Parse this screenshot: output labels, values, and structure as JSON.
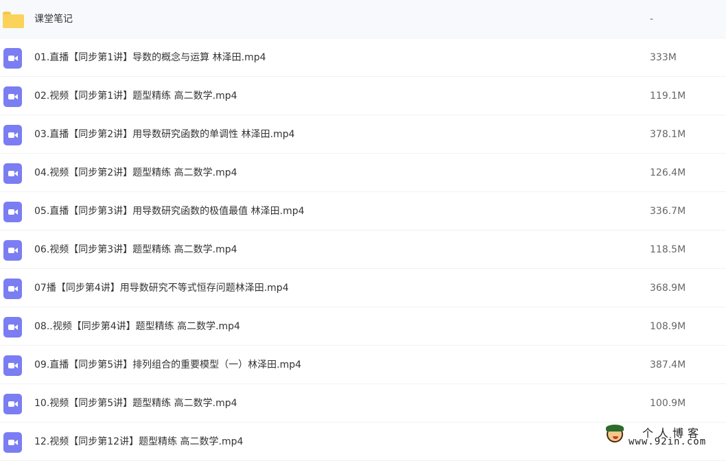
{
  "files": [
    {
      "name": "课堂笔记",
      "size": "-",
      "type": "folder",
      "icon": "folder-icon"
    },
    {
      "name": "01.直播【同步第1讲】导数的概念与运算 林泽田.mp4",
      "size": "333M",
      "type": "video",
      "icon": "video-file-icon"
    },
    {
      "name": "02.视频【同步第1讲】题型精练 高二数学.mp4",
      "size": "119.1M",
      "type": "video",
      "icon": "video-file-icon"
    },
    {
      "name": "03.直播【同步第2讲】用导数研究函数的单调性 林泽田.mp4",
      "size": "378.1M",
      "type": "video",
      "icon": "video-file-icon"
    },
    {
      "name": "04.视频【同步第2讲】题型精练 高二数学.mp4",
      "size": "126.4M",
      "type": "video",
      "icon": "video-file-icon"
    },
    {
      "name": "05.直播【同步第3讲】用导数研究函数的极值最值 林泽田.mp4",
      "size": "336.7M",
      "type": "video",
      "icon": "video-file-icon"
    },
    {
      "name": "06.视频【同步第3讲】题型精练 高二数学.mp4",
      "size": "118.5M",
      "type": "video",
      "icon": "video-file-icon"
    },
    {
      "name": "07播【同步第4讲】用导数研究不等式恒存问题林泽田.mp4",
      "size": "368.9M",
      "type": "video",
      "icon": "video-file-icon"
    },
    {
      "name": "08..视频【同步第4讲】题型精练 高二数学.mp4",
      "size": "108.9M",
      "type": "video",
      "icon": "video-file-icon"
    },
    {
      "name": "09.直播【同步第5讲】排列组合的重要模型（一）林泽田.mp4",
      "size": "387.4M",
      "type": "video",
      "icon": "video-file-icon"
    },
    {
      "name": "10.视频【同步第5讲】题型精练 高二数学.mp4",
      "size": "100.9M",
      "type": "video",
      "icon": "video-file-icon"
    },
    {
      "name": "12.视频【同步第12讲】题型精练 高二数学.mp4",
      "size": "",
      "type": "video",
      "icon": "video-file-icon"
    }
  ],
  "watermark": {
    "title": "个人博客",
    "url": "www.92in.com",
    "icon": "mascot-logo-icon"
  },
  "colors": {
    "folder": "#fbd35a",
    "video_icon": "#7b7df2",
    "text": "#333333",
    "size_text": "#666666",
    "divider": "#f1f2f4"
  }
}
